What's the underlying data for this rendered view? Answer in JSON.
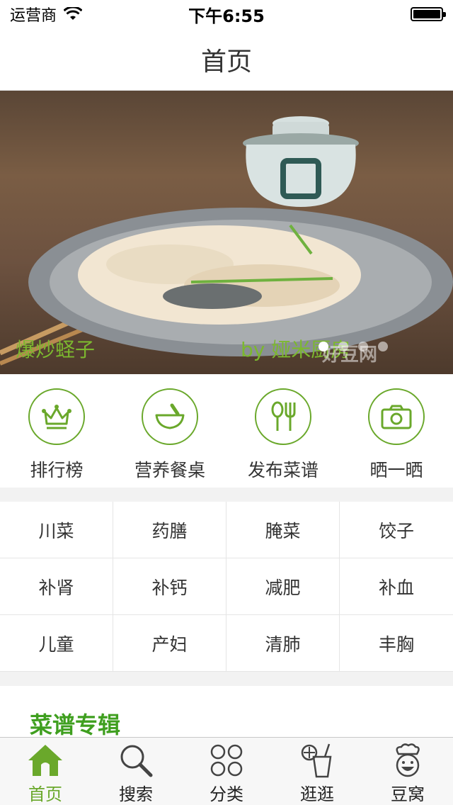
{
  "status_bar": {
    "carrier": "运营商",
    "time": "下午6:55"
  },
  "nav": {
    "title": "首页"
  },
  "banner": {
    "caption": "爆炒蛏子",
    "author": "by  娅米厨房",
    "watermark": "好豆网",
    "slide_count": 4,
    "active_slide": 0
  },
  "features": [
    {
      "label": "排行榜",
      "icon": "crown-icon"
    },
    {
      "label": "营养餐桌",
      "icon": "mortar-icon"
    },
    {
      "label": "发布菜谱",
      "icon": "utensils-icon"
    },
    {
      "label": "晒一晒",
      "icon": "camera-icon"
    }
  ],
  "categories": [
    "川菜",
    "药膳",
    "腌菜",
    "饺子",
    "补肾",
    "补钙",
    "减肥",
    "补血",
    "儿童",
    "产妇",
    "清肺",
    "丰胸"
  ],
  "section": {
    "title": "菜谱专辑"
  },
  "tabs": [
    {
      "label": "首页",
      "icon": "home-icon",
      "active": true
    },
    {
      "label": "搜索",
      "icon": "search-icon",
      "active": false
    },
    {
      "label": "分类",
      "icon": "grid-icon",
      "active": false
    },
    {
      "label": "逛逛",
      "icon": "drink-icon",
      "active": false
    },
    {
      "label": "豆窝",
      "icon": "chef-icon",
      "active": false
    }
  ],
  "colors": {
    "accent": "#6aa82b",
    "section_title": "#3f9f1f",
    "caption": "#7cb82f"
  }
}
